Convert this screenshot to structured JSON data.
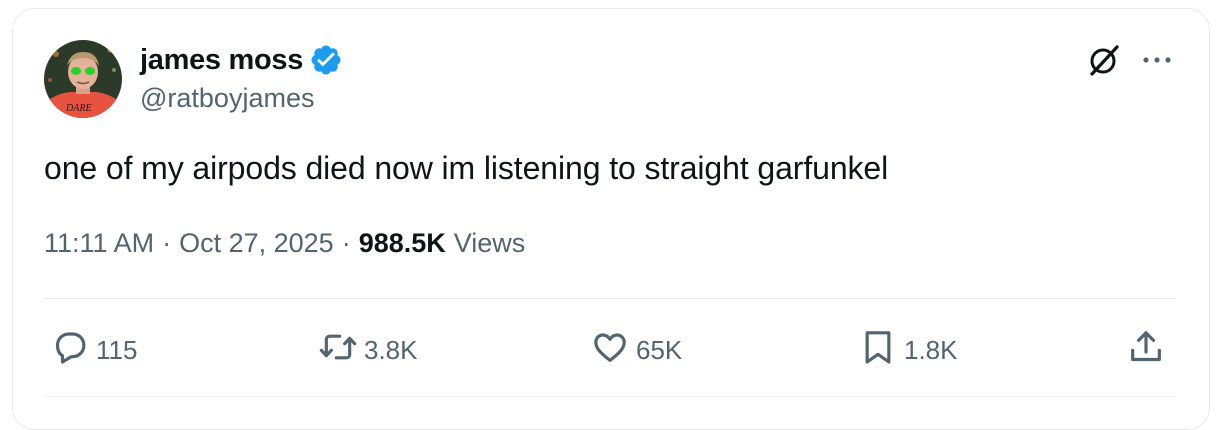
{
  "author": {
    "display_name": "james moss",
    "handle": "@ratboyjames",
    "verified": true,
    "verified_color": "#1d9bf0",
    "avatar_shirt_text": "DARE"
  },
  "tweet": {
    "text": "one of my airpods died now im listening to straight garfunkel",
    "time": "11:11 AM",
    "separator": "·",
    "date": "Oct 27, 2025",
    "views_count": "988.5K",
    "views_label": "Views"
  },
  "actions": {
    "replies": "115",
    "retweets": "3.8K",
    "likes": "65K",
    "bookmarks": "1.8K"
  },
  "icons": [
    "grok-icon",
    "more-icon",
    "reply-icon",
    "retweet-icon",
    "like-icon",
    "bookmark-icon",
    "share-icon",
    "verified-icon"
  ],
  "colors": {
    "text_primary": "#0f1419",
    "text_secondary": "#536471",
    "border": "#e6e9ec"
  }
}
